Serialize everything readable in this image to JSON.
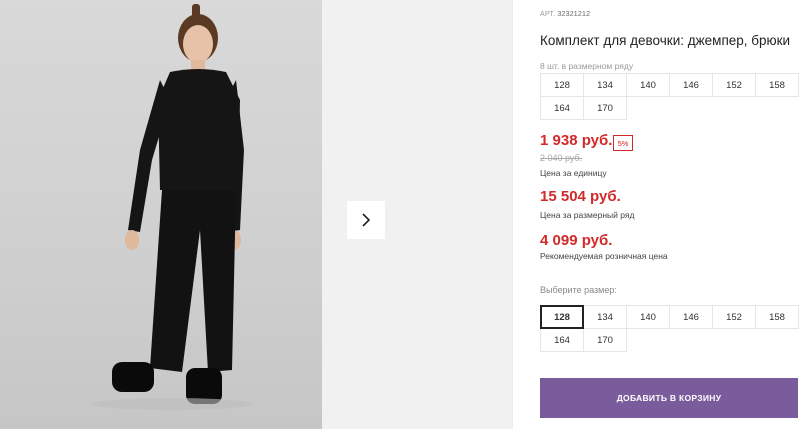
{
  "product": {
    "article_label": "АРТ.",
    "article_number": "32321212",
    "title": "Комплект для девочки: джемпер, брюки",
    "range_note": "8 шт. в размерном ряду",
    "range_sizes": [
      "128",
      "134",
      "140",
      "146",
      "152",
      "158",
      "164",
      "170"
    ]
  },
  "pricing": {
    "unit_price": "1 938 руб.",
    "discount_badge": "5%",
    "old_price": "2 040 руб.",
    "unit_price_note": "Цена за единицу",
    "range_price": "15 504 руб.",
    "range_price_note": "Цена за размерный ряд",
    "retail_price": "4 099 руб.",
    "retail_price_note": "Рекомендуемая розничная цена"
  },
  "size_selector": {
    "label": "Выберите размер:",
    "sizes": [
      "128",
      "134",
      "140",
      "146",
      "152",
      "158",
      "164",
      "170"
    ],
    "selected": "128"
  },
  "actions": {
    "add_to_cart_label": "ДОБАВИТЬ В КОРЗИНУ"
  },
  "gallery": {
    "next_icon": "chevron-right-icon"
  },
  "colors": {
    "accent_button": "#7a5c9c",
    "price_red": "#d12a2a"
  }
}
